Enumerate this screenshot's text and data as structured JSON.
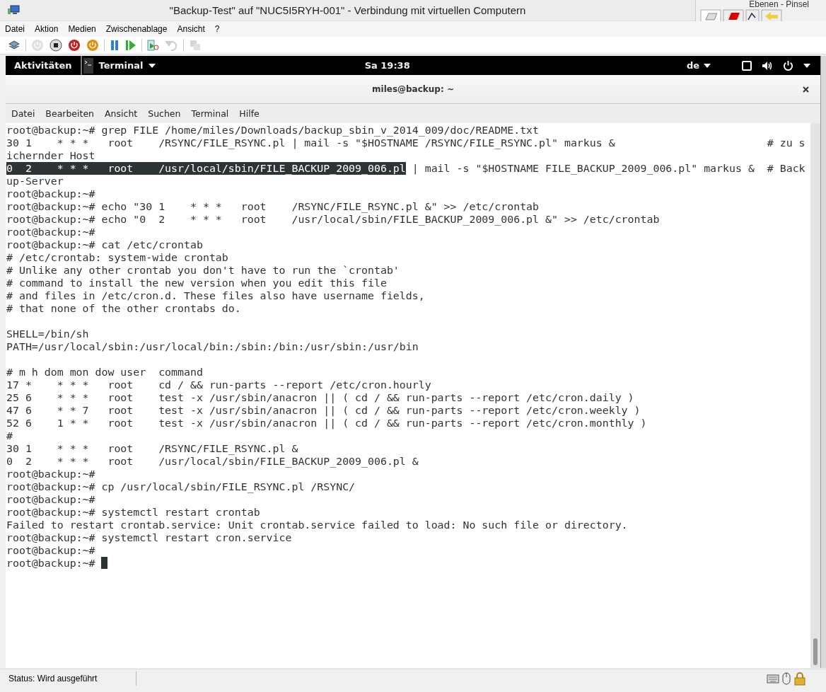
{
  "window": {
    "title": "\"Backup-Test\" auf \"NUC5I5RYH-001\" - Verbindung mit virtuellen Computern"
  },
  "side_panel": {
    "title": "Ebenen - Pinsel"
  },
  "menu": [
    "Datei",
    "Aktion",
    "Medien",
    "Zwischenablage",
    "Ansicht",
    "?"
  ],
  "toolbar": [
    {
      "kind": "network",
      "disabled": false
    },
    {
      "kind": "sep"
    },
    {
      "kind": "power",
      "disabled": true
    },
    {
      "kind": "stop",
      "disabled": false
    },
    {
      "kind": "shutdown",
      "disabled": false
    },
    {
      "kind": "save",
      "disabled": false
    },
    {
      "kind": "sep"
    },
    {
      "kind": "pause",
      "disabled": false
    },
    {
      "kind": "play",
      "disabled": false
    },
    {
      "kind": "sep"
    },
    {
      "kind": "snapshot",
      "disabled": false
    },
    {
      "kind": "revert",
      "disabled": true
    },
    {
      "kind": "sep"
    },
    {
      "kind": "share",
      "disabled": true
    }
  ],
  "gnome_bar": {
    "activities": "Aktivitäten",
    "app": "Terminal",
    "clock": "Sa 19:38",
    "keyboard": "de"
  },
  "terminal": {
    "title": "miles@backup: ~",
    "menu": [
      "Datei",
      "Bearbeiten",
      "Ansicht",
      "Suchen",
      "Terminal",
      "Hilfe"
    ],
    "lines": [
      {
        "kind": "text",
        "text": "root@backup:~# grep FILE /home/miles/Downloads/backup_sbin_v_2014_009/doc/README.txt"
      },
      {
        "kind": "text",
        "text": "30 1    * * *   root    /RSYNC/FILE_RSYNC.pl | mail -s \"$HOSTNAME /RSYNC/FILE_RSYNC.pl\" markus &                        # zu s"
      },
      {
        "kind": "text",
        "text": "ichernder Host"
      },
      {
        "kind": "selection",
        "selected": "0  2    * * *   root    /usr/local/sbin/FILE_BACKUP_2009_006.pl",
        "text": " | mail -s \"$HOSTNAME FILE_BACKUP_2009_006.pl\" markus &  # Back"
      },
      {
        "kind": "text",
        "text": "up-Server"
      },
      {
        "kind": "text",
        "text": "root@backup:~#"
      },
      {
        "kind": "text",
        "text": "root@backup:~# echo \"30 1    * * *   root    /RSYNC/FILE_RSYNC.pl &\" >> /etc/crontab"
      },
      {
        "kind": "text",
        "text": "root@backup:~# echo \"0  2    * * *   root    /usr/local/sbin/FILE_BACKUP_2009_006.pl &\" >> /etc/crontab"
      },
      {
        "kind": "text",
        "text": "root@backup:~#"
      },
      {
        "kind": "text",
        "text": "root@backup:~# cat /etc/crontab"
      },
      {
        "kind": "text",
        "text": "# /etc/crontab: system-wide crontab"
      },
      {
        "kind": "text",
        "text": "# Unlike any other crontab you don't have to run the `crontab'"
      },
      {
        "kind": "text",
        "text": "# command to install the new version when you edit this file"
      },
      {
        "kind": "text",
        "text": "# and files in /etc/cron.d. These files also have username fields,"
      },
      {
        "kind": "text",
        "text": "# that none of the other crontabs do."
      },
      {
        "kind": "blank"
      },
      {
        "kind": "text",
        "text": "SHELL=/bin/sh"
      },
      {
        "kind": "text",
        "text": "PATH=/usr/local/sbin:/usr/local/bin:/sbin:/bin:/usr/sbin:/usr/bin"
      },
      {
        "kind": "blank"
      },
      {
        "kind": "text",
        "text": "# m h dom mon dow user  command"
      },
      {
        "kind": "text",
        "text": "17 *    * * *   root    cd / && run-parts --report /etc/cron.hourly"
      },
      {
        "kind": "text",
        "text": "25 6    * * *   root    test -x /usr/sbin/anacron || ( cd / && run-parts --report /etc/cron.daily )"
      },
      {
        "kind": "text",
        "text": "47 6    * * 7   root    test -x /usr/sbin/anacron || ( cd / && run-parts --report /etc/cron.weekly )"
      },
      {
        "kind": "text",
        "text": "52 6    1 * *   root    test -x /usr/sbin/anacron || ( cd / && run-parts --report /etc/cron.monthly )"
      },
      {
        "kind": "text",
        "text": "#"
      },
      {
        "kind": "text",
        "text": "30 1    * * *   root    /RSYNC/FILE_RSYNC.pl &"
      },
      {
        "kind": "text",
        "text": "0  2    * * *   root    /usr/local/sbin/FILE_BACKUP_2009_006.pl &"
      },
      {
        "kind": "text",
        "text": "root@backup:~#"
      },
      {
        "kind": "text",
        "text": "root@backup:~# cp /usr/local/sbin/FILE_RSYNC.pl /RSYNC/"
      },
      {
        "kind": "text",
        "text": "root@backup:~#"
      },
      {
        "kind": "text",
        "text": "root@backup:~# systemctl restart crontab"
      },
      {
        "kind": "text",
        "text": "Failed to restart crontab.service: Unit crontab.service failed to load: No such file or directory."
      },
      {
        "kind": "text",
        "text": "root@backup:~# systemctl restart cron.service"
      },
      {
        "kind": "text",
        "text": "root@backup:~#"
      },
      {
        "kind": "cursor",
        "text": "root@backup:~# "
      }
    ]
  },
  "status_bar": {
    "text": "Status: Wird ausgeführt"
  }
}
